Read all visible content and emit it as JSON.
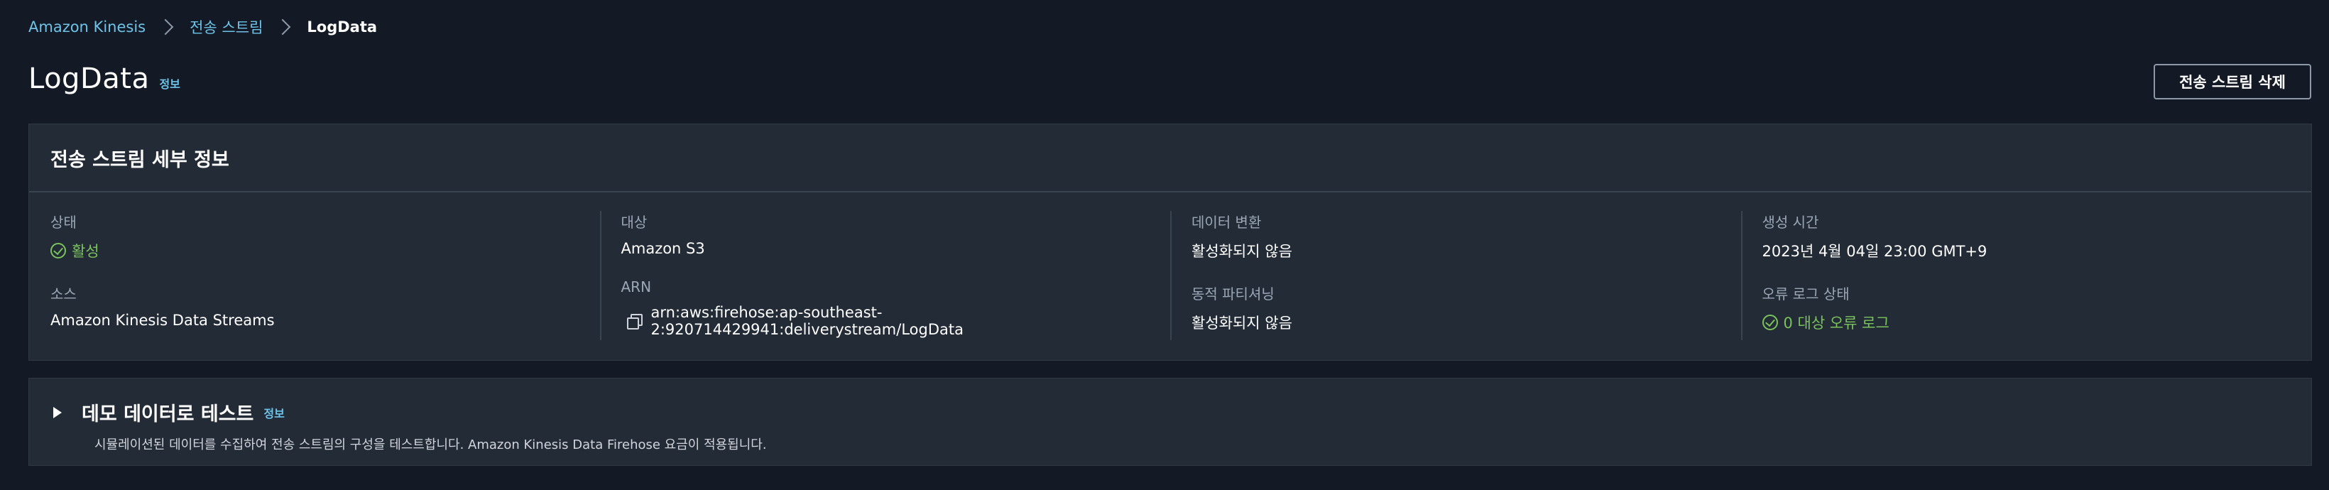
{
  "breadcrumb": {
    "items": [
      {
        "label": "Amazon Kinesis"
      },
      {
        "label": "전송 스트림"
      },
      {
        "label": "LogData"
      }
    ]
  },
  "header": {
    "title": "LogData",
    "info_label": "정보",
    "delete_button_label": "전송 스트림 삭제"
  },
  "details": {
    "title": "전송 스트림 세부 정보",
    "fields": {
      "status": {
        "label": "상태",
        "value": "활성",
        "icon": "check-circle-icon"
      },
      "source": {
        "label": "소스",
        "value": "Amazon Kinesis Data Streams"
      },
      "destination": {
        "label": "대상",
        "value": "Amazon S3"
      },
      "arn": {
        "label": "ARN",
        "value": "arn:aws:firehose:ap-southeast-2:920714429941:deliverystream/LogData",
        "icon": "copy-icon"
      },
      "data_transform": {
        "label": "데이터 변환",
        "value": "활성화되지 않음"
      },
      "dynamic_partitioning": {
        "label": "동적 파티셔닝",
        "value": "활성화되지 않음"
      },
      "created_at": {
        "label": "생성 시간",
        "value": "2023년 4월 04일 23:00 GMT+9"
      },
      "error_log_status": {
        "label": "오류 로그 상태",
        "value": "0 대상 오류 로그",
        "icon": "check-circle-icon"
      }
    }
  },
  "demo": {
    "title": "데모 데이터로 테스트",
    "info_label": "정보",
    "description": "시뮬레이션된 데이터를 수집하여 전송 스트림의 구성을 테스트합니다. Amazon Kinesis Data Firehose 요금이 적용됩니다.",
    "expanded": false
  },
  "colors": {
    "background": "#131a25",
    "panel": "#232b37",
    "link": "#6ec3e8",
    "success": "#7ac25b"
  }
}
